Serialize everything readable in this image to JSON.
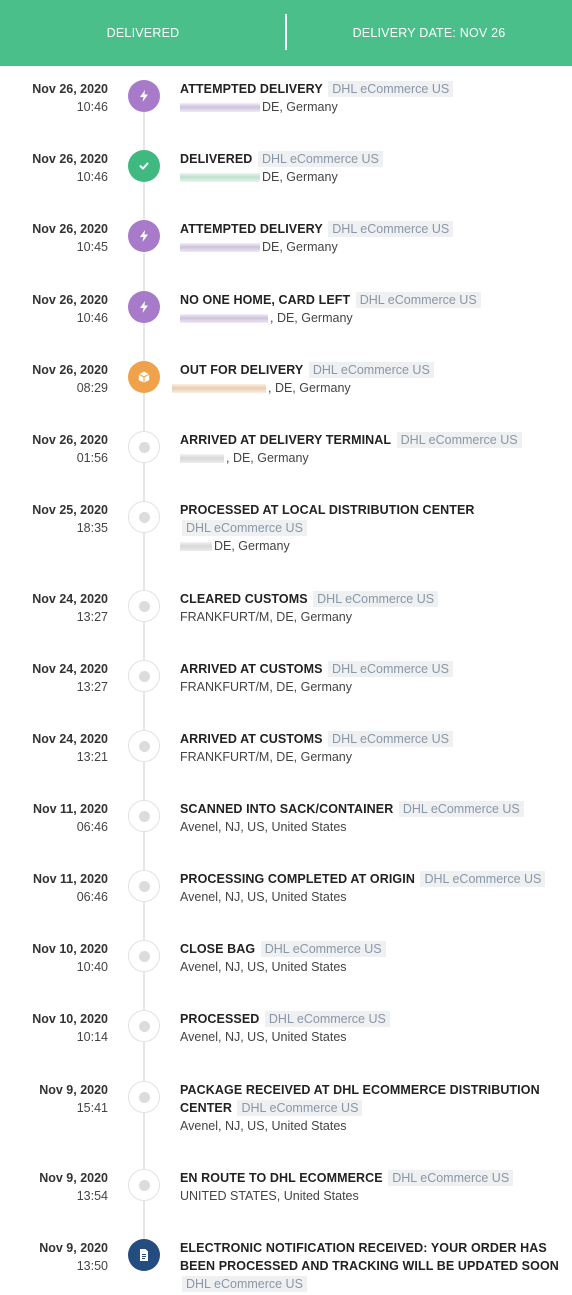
{
  "header": {
    "status_label": "DELIVERED",
    "delivery_date_label": "DELIVERY DATE: NOV 26"
  },
  "colors": {
    "header_bg": "#4bbf8a",
    "attempt": "#a77bca",
    "delivered": "#3fb97f",
    "out_for_delivery": "#f0a24b",
    "notification": "#254c7e",
    "pending": "#dcdcdc"
  },
  "events": [
    {
      "date": "Nov 26, 2020",
      "time": "10:46",
      "status": "ATTEMPTED DELIVERY",
      "carrier": "DHL eCommerce US",
      "location": "DE, Germany",
      "icon": "lightning-icon"
    },
    {
      "date": "Nov 26, 2020",
      "time": "10:46",
      "status": "DELIVERED",
      "carrier": "DHL eCommerce US",
      "location": "DE, Germany",
      "icon": "checkmark-icon"
    },
    {
      "date": "Nov 26, 2020",
      "time": "10:45",
      "status": "ATTEMPTED DELIVERY",
      "carrier": "DHL eCommerce US",
      "location": "DE, Germany",
      "icon": "lightning-icon"
    },
    {
      "date": "Nov 26, 2020",
      "time": "10:46",
      "status": "NO ONE HOME, CARD LEFT",
      "carrier": "DHL eCommerce US",
      "location": ", DE, Germany",
      "icon": "lightning-icon"
    },
    {
      "date": "Nov 26, 2020",
      "time": "08:29",
      "status": "OUT FOR DELIVERY",
      "carrier": "DHL eCommerce US",
      "location": ", DE, Germany",
      "icon": "package-icon"
    },
    {
      "date": "Nov 26, 2020",
      "time": "01:56",
      "status": "ARRIVED AT DELIVERY TERMINAL",
      "carrier": "DHL eCommerce US",
      "location": ", DE, Germany",
      "icon": "dot-icon"
    },
    {
      "date": "Nov 25, 2020",
      "time": "18:35",
      "status": "PROCESSED AT LOCAL DISTRIBUTION CENTER",
      "carrier": "DHL eCommerce US",
      "location": "DE, Germany",
      "icon": "dot-icon"
    },
    {
      "date": "Nov 24, 2020",
      "time": "13:27",
      "status": "CLEARED CUSTOMS",
      "carrier": "DHL eCommerce US",
      "location": "FRANKFURT/M, DE, Germany",
      "icon": "dot-icon"
    },
    {
      "date": "Nov 24, 2020",
      "time": "13:27",
      "status": "ARRIVED AT CUSTOMS",
      "carrier": "DHL eCommerce US",
      "location": "FRANKFURT/M, DE, Germany",
      "icon": "dot-icon"
    },
    {
      "date": "Nov 24, 2020",
      "time": "13:21",
      "status": "ARRIVED AT CUSTOMS",
      "carrier": "DHL eCommerce US",
      "location": "FRANKFURT/M, DE, Germany",
      "icon": "dot-icon"
    },
    {
      "date": "Nov 11, 2020",
      "time": "06:46",
      "status": "SCANNED INTO SACK/CONTAINER",
      "carrier": "DHL eCommerce US",
      "location": "Avenel, NJ, US, United States",
      "icon": "dot-icon"
    },
    {
      "date": "Nov 11, 2020",
      "time": "06:46",
      "status": "PROCESSING COMPLETED AT ORIGIN",
      "carrier": "DHL eCommerce US",
      "location": "Avenel, NJ, US, United States",
      "icon": "dot-icon"
    },
    {
      "date": "Nov 10, 2020",
      "time": "10:40",
      "status": "CLOSE BAG",
      "carrier": "DHL eCommerce US",
      "location": "Avenel, NJ, US, United States",
      "icon": "dot-icon"
    },
    {
      "date": "Nov 10, 2020",
      "time": "10:14",
      "status": "PROCESSED",
      "carrier": "DHL eCommerce US",
      "location": "Avenel, NJ, US, United States",
      "icon": "dot-icon"
    },
    {
      "date": "Nov 9, 2020",
      "time": "15:41",
      "status": "PACKAGE RECEIVED AT DHL ECOMMERCE DISTRIBUTION CENTER",
      "carrier": "DHL eCommerce US",
      "location": "Avenel, NJ, US, United States",
      "icon": "dot-icon"
    },
    {
      "date": "Nov 9, 2020",
      "time": "13:54",
      "status": "EN ROUTE TO DHL ECOMMERCE",
      "carrier": "DHL eCommerce US",
      "location": "UNITED STATES, United States",
      "icon": "dot-icon"
    },
    {
      "date": "Nov 9, 2020",
      "time": "13:50",
      "status": "ELECTRONIC NOTIFICATION RECEIVED: YOUR ORDER HAS BEEN PROCESSED AND TRACKING WILL BE UPDATED SOON",
      "carrier": "DHL eCommerce US",
      "location": "",
      "icon": "document-icon"
    }
  ]
}
